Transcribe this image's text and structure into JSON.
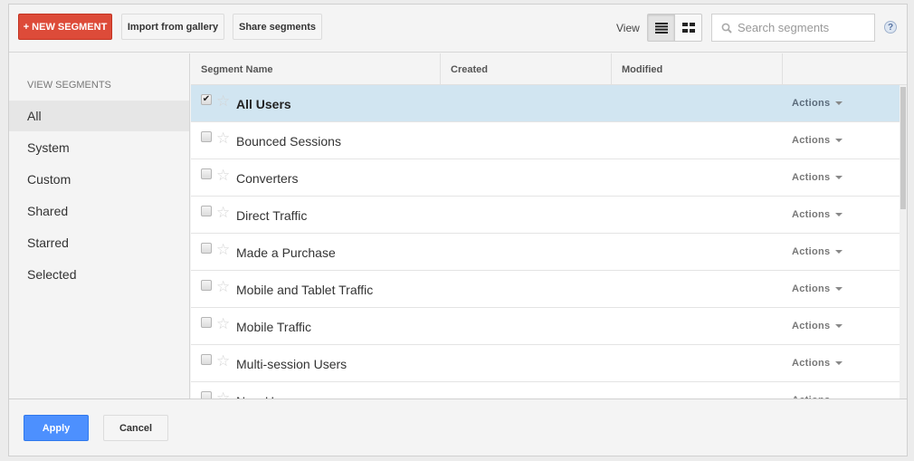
{
  "toolbar": {
    "new_segment_label": "+ NEW SEGMENT",
    "import_label": "Import from gallery",
    "share_label": "Share segments",
    "view_label": "View",
    "view_modes": [
      "list",
      "grid"
    ],
    "active_view": "list",
    "search_placeholder": "Search segments",
    "search_value": "",
    "help_label": "?"
  },
  "sidebar": {
    "header": "VIEW SEGMENTS",
    "items": [
      {
        "label": "All",
        "active": true
      },
      {
        "label": "System",
        "active": false
      },
      {
        "label": "Custom",
        "active": false
      },
      {
        "label": "Shared",
        "active": false
      },
      {
        "label": "Starred",
        "active": false
      },
      {
        "label": "Selected",
        "active": false
      }
    ]
  },
  "table": {
    "columns": [
      "Segment Name",
      "Created",
      "Modified",
      ""
    ],
    "action_label": "Actions",
    "rows": [
      {
        "name": "All Users",
        "checked": true,
        "created": "",
        "modified": ""
      },
      {
        "name": "Bounced Sessions",
        "checked": false,
        "created": "",
        "modified": ""
      },
      {
        "name": "Converters",
        "checked": false,
        "created": "",
        "modified": ""
      },
      {
        "name": "Direct Traffic",
        "checked": false,
        "created": "",
        "modified": ""
      },
      {
        "name": "Made a Purchase",
        "checked": false,
        "created": "",
        "modified": ""
      },
      {
        "name": "Mobile and Tablet Traffic",
        "checked": false,
        "created": "",
        "modified": ""
      },
      {
        "name": "Mobile Traffic",
        "checked": false,
        "created": "",
        "modified": ""
      },
      {
        "name": "Multi-session Users",
        "checked": false,
        "created": "",
        "modified": ""
      },
      {
        "name": "New Users",
        "checked": false,
        "created": "",
        "modified": ""
      }
    ]
  },
  "footer": {
    "apply_label": "Apply",
    "cancel_label": "Cancel"
  },
  "colors": {
    "new_segment_bg": "#dd4b39",
    "apply_bg": "#4d90fe",
    "selected_row_bg": "#d1e5f1"
  }
}
